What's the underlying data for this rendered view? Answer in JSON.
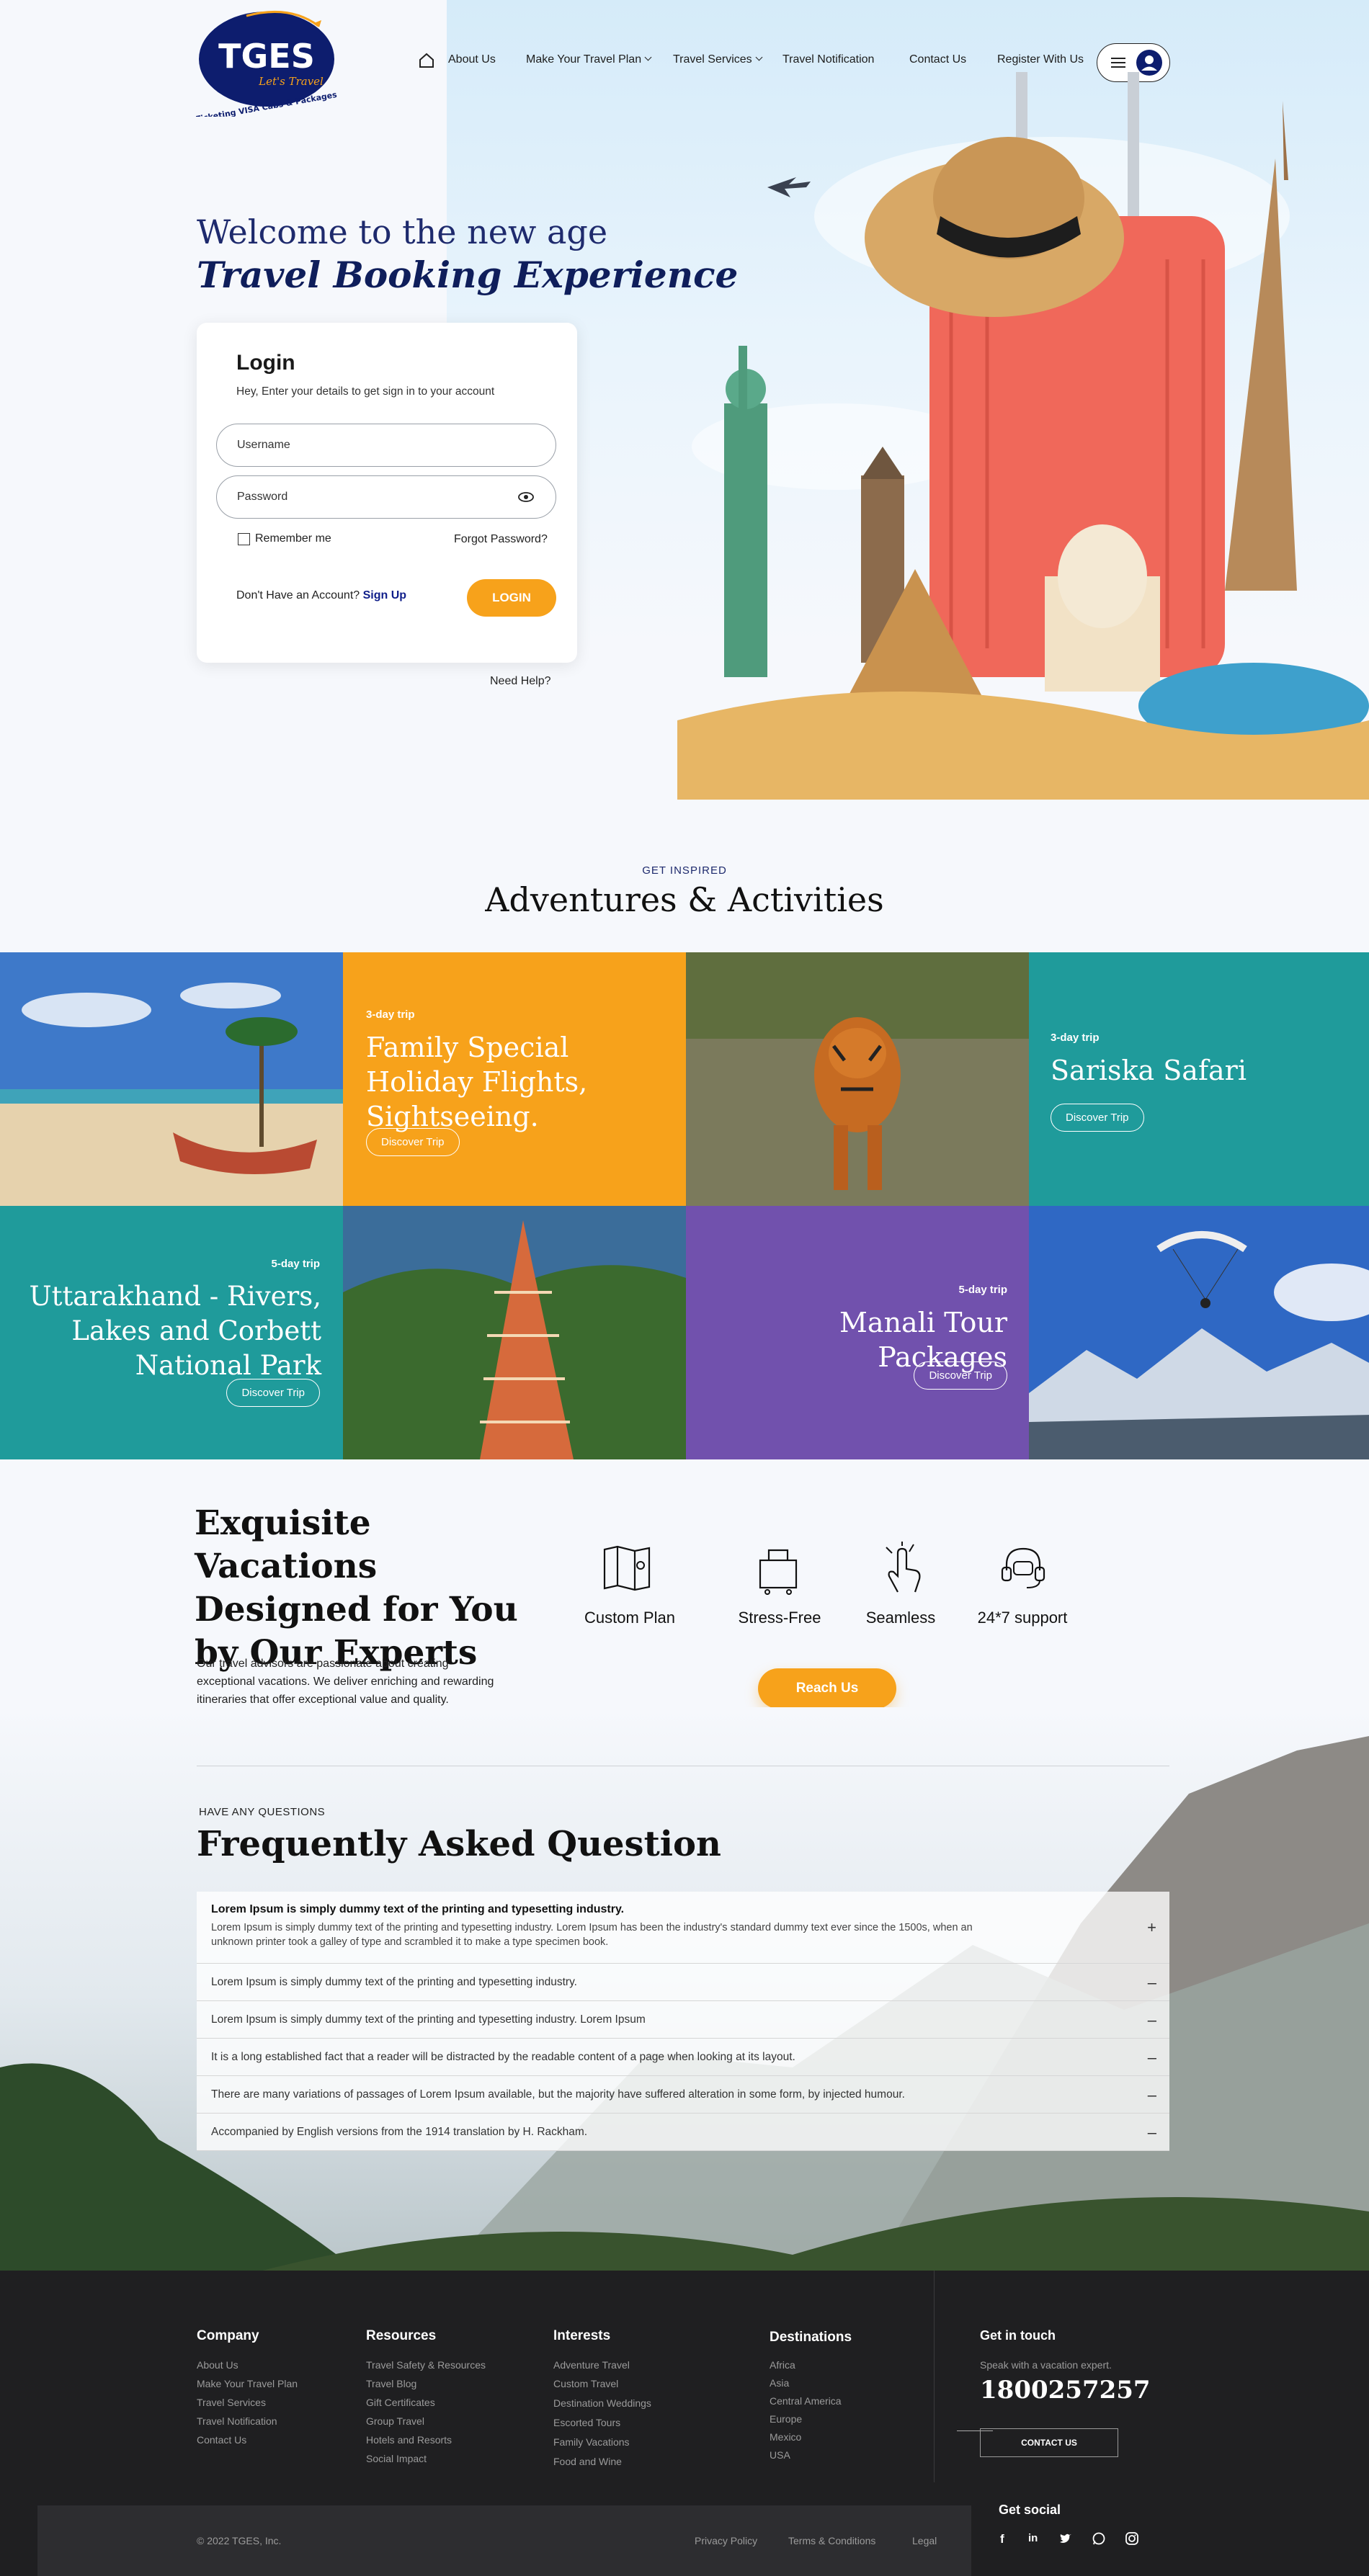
{
  "header": {
    "logo_text": "TGES",
    "logo_tagline": "Let's Travel",
    "logo_subtext": "Ticketing VISA Cabs & Packages",
    "nav": [
      {
        "label": "About Us"
      },
      {
        "label": "Make Your Travel Plan"
      },
      {
        "label": "Travel Services"
      },
      {
        "label": "Travel Notification"
      },
      {
        "label": "Contact Us"
      },
      {
        "label": "Register With Us"
      }
    ]
  },
  "hero": {
    "line1": "Welcome to the new age",
    "line2": "Travel Booking Experience"
  },
  "login": {
    "title": "Login",
    "subtitle": "Hey, Enter your details to get sign in to your account",
    "username_placeholder": "Username",
    "password_placeholder": "Password",
    "remember": "Remember me",
    "forgot": "Forgot Password?",
    "no_account": "Don't Have an Account?",
    "signup": "Sign Up",
    "button": "LOGIN",
    "help": "Need Help?"
  },
  "adventures": {
    "eyebrow": "GET INSPIRED",
    "title": "Adventures & Activities",
    "cards": [
      {
        "label": "3-day trip",
        "title": "Family Special Holiday Flights, Sightseeing.",
        "button": "Discover Trip"
      },
      {
        "label": "3-day trip",
        "title": "Sariska Safari",
        "button": "Discover Trip"
      },
      {
        "label": "5-day trip",
        "title": "Uttarakhand - Rivers, Lakes and Corbett National Park",
        "button": "Discover Trip"
      },
      {
        "label": "5-day trip",
        "title": "Manali Tour Packages",
        "button": "Discover Trip"
      }
    ]
  },
  "vacations": {
    "title": "Exquisite Vacations Designed for You by Our Experts",
    "body": "Our travel advisors are passionate about creating exceptional vacations. We deliver enriching and rewarding itineraries that offer exceptional value and quality.",
    "features": [
      {
        "label": "Custom Plan"
      },
      {
        "label": "Stress-Free"
      },
      {
        "label": "Seamless"
      },
      {
        "label": "24*7 support"
      }
    ],
    "button": "Reach Us"
  },
  "faq": {
    "eyebrow": "HAVE ANY QUESTIONS",
    "title": "Frequently Asked Question",
    "items": [
      {
        "q": "Lorem Ipsum is simply dummy text of the printing and typesetting industry.",
        "a": "Lorem Ipsum is simply dummy text of the printing and typesetting industry. Lorem Ipsum has been the industry's standard dummy text ever since the 1500s, when an unknown printer took a galley of type and scrambled it to make a type specimen book.",
        "sign": "+"
      },
      {
        "q": "Lorem Ipsum is simply dummy text of the printing and typesetting industry.",
        "sign": "–"
      },
      {
        "q": "Lorem Ipsum is simply dummy text of the printing and typesetting industry. Lorem Ipsum",
        "sign": "–"
      },
      {
        "q": "It is a long established fact that a reader will be distracted by the readable content of a page when looking at its layout.",
        "sign": "–"
      },
      {
        "q": "There are many variations of passages of Lorem Ipsum available, but the majority have suffered alteration in some form, by injected humour.",
        "sign": "–"
      },
      {
        "q": "Accompanied by English versions from the 1914 translation by H. Rackham.",
        "sign": "–"
      }
    ]
  },
  "footer": {
    "company": {
      "title": "Company",
      "links": [
        "About Us",
        "Make Your Travel Plan",
        "Travel Services",
        "Travel Notification",
        "Contact Us"
      ]
    },
    "resources": {
      "title": "Resources",
      "links": [
        "Travel Safety & Resources",
        "Travel Blog",
        "Gift Certificates",
        "Group Travel",
        "Hotels and Resorts",
        "Social Impact"
      ]
    },
    "interests": {
      "title": "Interests",
      "links": [
        "Adventure Travel",
        "Custom Travel",
        "Destination Weddings",
        "Escorted Tours",
        "Family Vacations",
        "Food and Wine"
      ]
    },
    "destinations": {
      "title": "Destinations",
      "links": [
        "Africa",
        "Asia",
        "Central America",
        "Europe",
        "Mexico",
        "USA"
      ]
    },
    "contact": {
      "title": "Get in touch",
      "subtitle": "Speak with a vacation expert.",
      "phone": "1800257257",
      "button": "CONTACT US"
    },
    "copyright": "© 2022 TGES, Inc.",
    "privacy": "Privacy Policy",
    "terms": "Terms & Conditions",
    "legal": "Legal",
    "social_title": "Get social",
    "social": [
      {
        "icon": "f"
      },
      {
        "icon": "in"
      },
      {
        "icon": "t"
      },
      {
        "icon": "w"
      },
      {
        "icon": "ig"
      }
    ]
  },
  "colors": {
    "navy": "#0f1e5b",
    "orange": "#f7a21b",
    "teal": "#1f9b9b",
    "purple": "#7151ad",
    "footer": "#1f1f21"
  }
}
